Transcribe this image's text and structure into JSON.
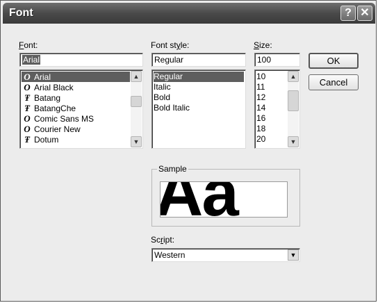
{
  "window": {
    "title": "Font",
    "help_glyph": "?",
    "close_glyph": "✕"
  },
  "labels": {
    "font": "Font:",
    "font_mnemonic": "F",
    "font_rest": "ont:",
    "style_pre": "Font st",
    "style_mn": "y",
    "style_post": "le:",
    "size_mn": "S",
    "size_rest": "ize:",
    "sample": "Sample",
    "script_pre": "Sc",
    "script_mn": "r",
    "script_post": "ipt:"
  },
  "font_field": {
    "value": "Arial"
  },
  "style_field": {
    "value": "Regular"
  },
  "size_field": {
    "value": "100"
  },
  "font_list": [
    {
      "label": "Arial",
      "icon": "O",
      "icon_name": "opentype-icon",
      "selected": true
    },
    {
      "label": "Arial Black",
      "icon": "O",
      "icon_name": "opentype-icon",
      "selected": false
    },
    {
      "label": "Batang",
      "icon": "Ŧ",
      "icon_name": "truetype-icon",
      "selected": false
    },
    {
      "label": "BatangChe",
      "icon": "Ŧ",
      "icon_name": "truetype-icon",
      "selected": false
    },
    {
      "label": "Comic Sans MS",
      "icon": "O",
      "icon_name": "opentype-icon",
      "selected": false
    },
    {
      "label": "Courier New",
      "icon": "O",
      "icon_name": "opentype-icon",
      "selected": false
    },
    {
      "label": "Dotum",
      "icon": "Ŧ",
      "icon_name": "truetype-icon",
      "selected": false
    }
  ],
  "style_list": [
    {
      "label": "Regular",
      "selected": true
    },
    {
      "label": "Italic",
      "selected": false
    },
    {
      "label": "Bold",
      "selected": false
    },
    {
      "label": "Bold Italic",
      "selected": false
    }
  ],
  "size_list": [
    "10",
    "11",
    "12",
    "14",
    "16",
    "18",
    "20"
  ],
  "buttons": {
    "ok": "OK",
    "cancel": "Cancel"
  },
  "sample_text": "Aa",
  "script": {
    "value": "Western"
  }
}
